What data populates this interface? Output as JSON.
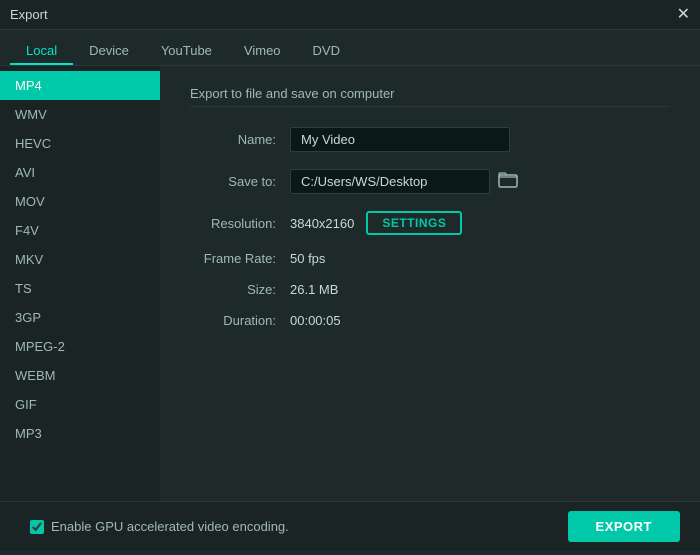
{
  "titleBar": {
    "title": "Export",
    "closeLabel": "✕"
  },
  "tabs": [
    {
      "id": "local",
      "label": "Local",
      "active": true
    },
    {
      "id": "device",
      "label": "Device",
      "active": false
    },
    {
      "id": "youtube",
      "label": "YouTube",
      "active": false
    },
    {
      "id": "vimeo",
      "label": "Vimeo",
      "active": false
    },
    {
      "id": "dvd",
      "label": "DVD",
      "active": false
    }
  ],
  "sidebar": {
    "items": [
      {
        "id": "mp4",
        "label": "MP4",
        "active": true
      },
      {
        "id": "wmv",
        "label": "WMV",
        "active": false
      },
      {
        "id": "hevc",
        "label": "HEVC",
        "active": false
      },
      {
        "id": "avi",
        "label": "AVI",
        "active": false
      },
      {
        "id": "mov",
        "label": "MOV",
        "active": false
      },
      {
        "id": "f4v",
        "label": "F4V",
        "active": false
      },
      {
        "id": "mkv",
        "label": "MKV",
        "active": false
      },
      {
        "id": "ts",
        "label": "TS",
        "active": false
      },
      {
        "id": "3gp",
        "label": "3GP",
        "active": false
      },
      {
        "id": "mpeg2",
        "label": "MPEG-2",
        "active": false
      },
      {
        "id": "webm",
        "label": "WEBM",
        "active": false
      },
      {
        "id": "gif",
        "label": "GIF",
        "active": false
      },
      {
        "id": "mp3",
        "label": "MP3",
        "active": false
      }
    ]
  },
  "content": {
    "sectionTitle": "Export to file and save on computer",
    "nameLabel": "Name:",
    "nameValue": "My Video",
    "saveToLabel": "Save to:",
    "saveToPath": "C:/Users/WS/Desktop",
    "resolutionLabel": "Resolution:",
    "resolutionValue": "3840x2160",
    "settingsLabel": "SETTINGS",
    "frameRateLabel": "Frame Rate:",
    "frameRateValue": "50 fps",
    "sizeLabel": "Size:",
    "sizeValue": "26.1 MB",
    "durationLabel": "Duration:",
    "durationValue": "00:00:05"
  },
  "footer": {
    "checkboxLabel": "Enable GPU accelerated video encoding.",
    "exportLabel": "EXPORT"
  },
  "icons": {
    "folder": "🗁",
    "folderUnicode": "📁"
  }
}
